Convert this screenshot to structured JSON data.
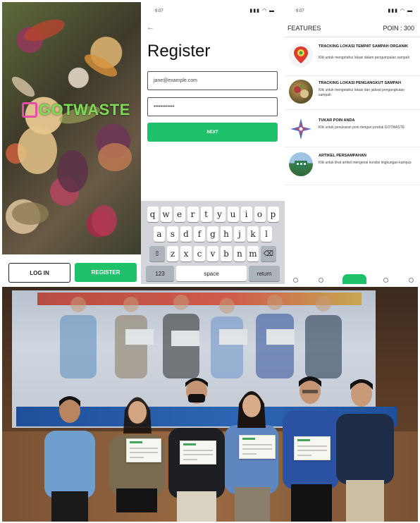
{
  "splash": {
    "logo_text": "GOTWASTE",
    "login_label": "LOG IN",
    "register_label": "REGISTER"
  },
  "register": {
    "status_time": "9:07",
    "back_glyph": "←",
    "title": "Register",
    "email_value": "jane@example.com",
    "password_value": "••••••••••••",
    "next_label": "NEXT",
    "keyboard": {
      "row1": [
        "q",
        "w",
        "e",
        "r",
        "t",
        "y",
        "u",
        "i",
        "o",
        "p"
      ],
      "row2": [
        "a",
        "s",
        "d",
        "f",
        "g",
        "h",
        "j",
        "k",
        "l"
      ],
      "row3": [
        "z",
        "x",
        "c",
        "v",
        "b",
        "n",
        "m"
      ],
      "num_label": "123",
      "space_label": "space",
      "return_label": "return"
    }
  },
  "features": {
    "status_time": "9:07",
    "header": "FEATURES",
    "points": "POIN : 300",
    "items": [
      {
        "title": "TRACKING LOKASI TEMPAT SAMPAH ORGANIK",
        "desc": "Klik untuk mengetahui lokasi dalam pengumpulan sampah",
        "icon": "map-pin-icon"
      },
      {
        "title": "TRACKING LOKASI PENGANGKUT SAMPAH",
        "desc": "Klik untuk mengetahui lokasi dan jadwal pengangkutan sampah",
        "icon": "waste-photo-icon"
      },
      {
        "title": "TUKAR POIN ANDA",
        "desc": "Klik untuk penukaran poin dengan produk GOTWASTE",
        "icon": "compass-star-icon"
      },
      {
        "title": "ARTIKEL PERSAMPAHAN",
        "desc": "Klik untuk lihat artikel mengenai kondisi lingkungan kampus",
        "icon": "building-photo-icon"
      }
    ]
  },
  "colors": {
    "accent_green": "#1fc16b",
    "logo_green": "#7ed957",
    "logo_pink": "#e64ea5"
  }
}
